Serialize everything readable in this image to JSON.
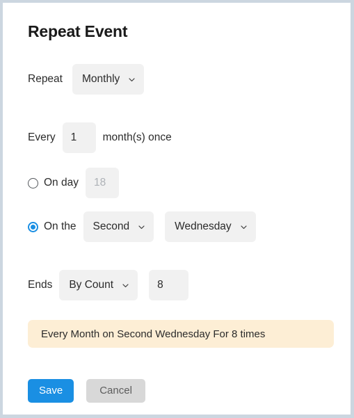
{
  "dialog": {
    "title": "Repeat Event"
  },
  "repeat_row": {
    "label": "Repeat",
    "frequency_value": "Monthly",
    "frequency_options": [
      "Monthly"
    ],
    "chevron_icon": "chevron-down-icon"
  },
  "every_row": {
    "prefix_label": "Every",
    "interval_value": "1",
    "suffix_label": "month(s) once"
  },
  "on_day_row": {
    "selected": false,
    "radio_icon": "radio-unchecked-icon",
    "label": "On day",
    "day_value": "18",
    "day_disabled": true
  },
  "on_the_row": {
    "selected": true,
    "radio_icon": "radio-checked-icon",
    "label": "On the",
    "ordinal_value": "Second",
    "ordinal_options": [
      "Second"
    ],
    "weekday_value": "Wednesday",
    "weekday_options": [
      "Wednesday"
    ],
    "chevron_icon": "chevron-down-icon"
  },
  "ends_row": {
    "label": "Ends",
    "mode_value": "By Count",
    "mode_options": [
      "By Count"
    ],
    "count_value": "8",
    "chevron_icon": "chevron-down-icon"
  },
  "summary": {
    "text": "Every Month on Second Wednesday For 8 times"
  },
  "footer": {
    "save_label": "Save",
    "cancel_label": "Cancel"
  },
  "colors": {
    "accent": "#1a8fe3",
    "field_bg": "#f1f1f1",
    "summary_bg": "#fdeed5",
    "cancel_bg": "#d8d8d8",
    "frame_border": "#ccd6e0",
    "disabled_text": "#aeb2b7"
  }
}
